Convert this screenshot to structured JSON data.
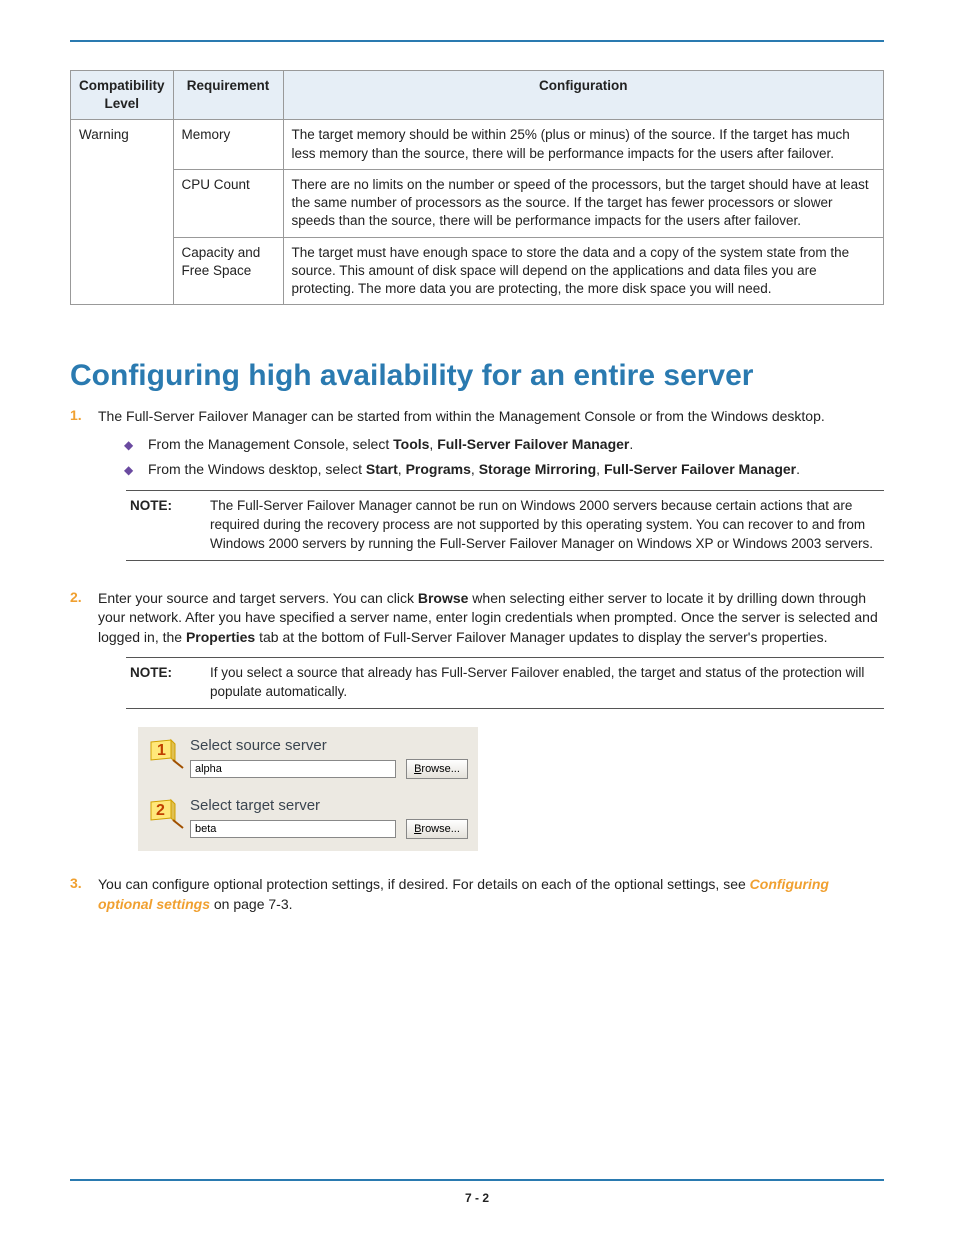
{
  "table": {
    "headers": [
      "Compatibility Level",
      "Requirement",
      "Configuration"
    ],
    "rows": [
      {
        "level": "Warning",
        "req": "Memory",
        "cfg": "The target memory should be within 25% (plus or minus) of the source. If the target has much less memory than the source, there will be performance impacts for the users after failover."
      },
      {
        "level": "",
        "req": "CPU Count",
        "cfg": "There are no limits on the number or speed of the processors, but the target should have at least the same number of processors as the source. If the target has fewer processors or slower speeds than the source, there will be performance impacts for the users after failover."
      },
      {
        "level": "",
        "req": "Capacity and Free Space",
        "cfg": "The target must have enough space to store the data and a copy of the system state from the source. This amount of disk space will depend on the applications and data files you are protecting. The more data you are protecting, the more disk space you will need."
      }
    ]
  },
  "heading": "Configuring high availability for an entire server",
  "steps": {
    "s1": {
      "num": "1.",
      "text": "The Full-Server Failover Manager can be started from within the Management Console or from the Windows desktop.",
      "bullets": {
        "b1_pre": "From the Management Console, select ",
        "b1_bold1": "Tools",
        "b1_mid": ", ",
        "b1_bold2": "Full-Server Failover Manager",
        "b1_post": ".",
        "b2_pre": "From the Windows desktop, select ",
        "b2_bold1": "Start",
        "b2_sep1": ", ",
        "b2_bold2": "Programs",
        "b2_sep2": ", ",
        "b2_bold3": "Storage Mirroring",
        "b2_sep3": ", ",
        "b2_bold4": "Full-Server Failover Manager",
        "b2_post": "."
      },
      "note_label": "NOTE:",
      "note": "The Full-Server Failover Manager cannot be run on Windows 2000 servers because certain actions that are required during the recovery process are not supported by this operating system.  You can recover to and from Windows 2000 servers by running the Full-Server Failover Manager on Windows XP or Windows 2003 servers."
    },
    "s2": {
      "num": "2.",
      "pre": "Enter your source and target servers. You can click ",
      "bold1": "Browse",
      "mid": " when selecting either server to locate it by drilling down through your network. After you have specified a server name, enter login credentials when prompted. Once the server is selected and logged in, the ",
      "bold2": "Properties",
      "post": " tab at the bottom of Full-Server Failover Manager updates to display the server's properties.",
      "note_label": "NOTE:",
      "note": "If you select a source that already has Full-Server Failover enabled, the target and status of the protection will populate automatically."
    },
    "s3": {
      "num": "3.",
      "pre": "You can configure optional protection settings, if desired. For details on each of the optional settings, see ",
      "link": "Configuring optional settings",
      "post": " on page 7-3."
    }
  },
  "selector": {
    "source_title": "Select source server",
    "source_value": "alpha",
    "target_title": "Select target server",
    "target_value": "beta",
    "browse_u": "B",
    "browse_rest": "rowse..."
  },
  "page_num": "7 - 2"
}
